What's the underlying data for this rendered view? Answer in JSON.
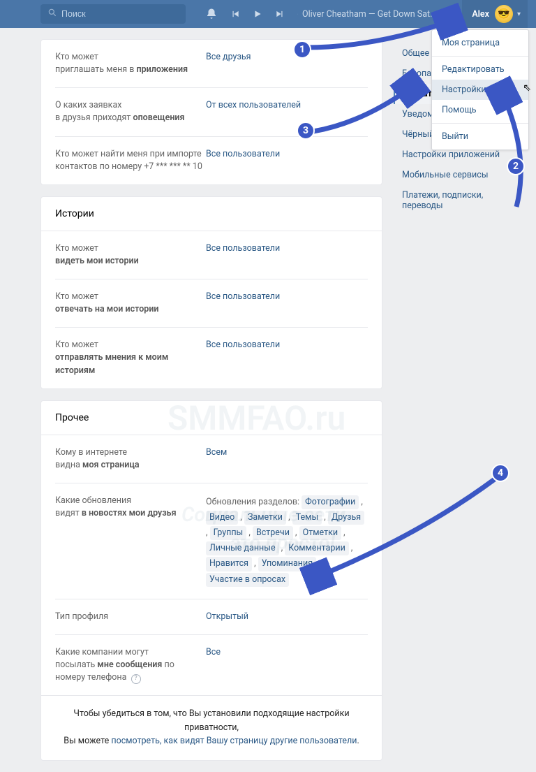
{
  "header": {
    "search_placeholder": "Поиск",
    "nowplaying": "Oliver Cheatham — Get Down Sat...",
    "username": "Alex"
  },
  "dropdown": {
    "items": [
      "Моя страница",
      "Редактировать",
      "Настройки",
      "Помощь",
      "Выйти"
    ]
  },
  "sidebar": {
    "items": [
      "Общее",
      "Безопасность",
      "Приватность",
      "Уведомления",
      "Чёрный список",
      "Настройки приложений",
      "Мобильные сервисы",
      "Платежи, подписки, переводы"
    ],
    "active_index": 2
  },
  "section_top": {
    "rows": [
      {
        "label_pre": "Кто может\nприглашать меня в ",
        "label_bold": "приложения",
        "value": "Все друзья"
      },
      {
        "label_pre": "О каких заявках\nв друзья приходят ",
        "label_bold": "оповещения",
        "value": "От всех пользователей"
      },
      {
        "label_pre": "Кто может найти меня при импорте\nконтактов по номеру +7 *** *** ** 10",
        "label_bold": "",
        "value": "Все пользователи"
      }
    ]
  },
  "section_stories": {
    "title": "Истории",
    "rows": [
      {
        "label_pre": "Кто может\n",
        "label_bold": "видеть мои истории",
        "value": "Все пользователи"
      },
      {
        "label_pre": "Кто может\n",
        "label_bold": "отвечать на мои истории",
        "value": "Все пользователи"
      },
      {
        "label_pre": "Кто может\n",
        "label_bold": "отправлять мнения к моим историям",
        "value": "Все пользователи"
      }
    ]
  },
  "section_other": {
    "title": "Прочее",
    "row_visible": {
      "label_pre": "Кому в интернете\nвидна ",
      "label_bold": "моя страница",
      "value": "Всем"
    },
    "row_updates": {
      "label_pre": "Какие обновления\nвидят ",
      "label_bold": "в новостях мои друзья",
      "prefix": "Обновления разделов: ",
      "chips": [
        "Фотографии",
        "Видео",
        "Заметки",
        "Темы",
        "Друзья",
        "Группы",
        "Встречи",
        "Отметки",
        "Личные данные",
        "Комментарии",
        "Нравится",
        "Упоминания",
        "Участие в опросах"
      ]
    },
    "row_type": {
      "label": "Тип профиля",
      "value": "Открытый"
    },
    "row_companies": {
      "label_pre": "Какие компании могут\nпосылать ",
      "label_bold": "мне сообщения",
      "label_post": " по номеру телефона",
      "value": "Все"
    }
  },
  "footer": {
    "line1": "Чтобы убедиться в том, что Вы установили подходящие настройки приватности,",
    "line2_pre": "Вы можете ",
    "line2_link": "посмотреть, как видят Вашу страницу другие пользователи",
    "line2_post": "."
  },
  "watermark": {
    "a": "SMMFAO.ru",
    "b": "Социальные сети",
    "c": "это просто!"
  },
  "badges": {
    "b1": "1",
    "b2": "2",
    "b3": "3",
    "b4": "4"
  }
}
